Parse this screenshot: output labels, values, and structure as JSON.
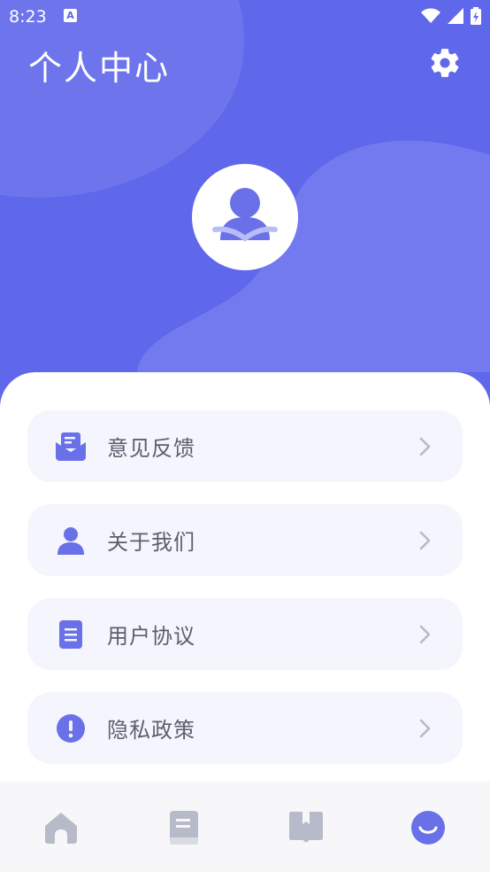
{
  "status_bar": {
    "time": "8:23",
    "notification_icon": "A"
  },
  "header": {
    "title": "个人中心"
  },
  "menu": {
    "items": [
      {
        "label": "意见反馈",
        "icon": "mail-icon"
      },
      {
        "label": "关于我们",
        "icon": "person-icon"
      },
      {
        "label": "用户协议",
        "icon": "document-icon"
      },
      {
        "label": "隐私政策",
        "icon": "exclamation-icon"
      }
    ]
  },
  "tabbar": {
    "tabs": [
      {
        "icon": "home-icon",
        "active": false
      },
      {
        "icon": "book-icon",
        "active": false
      },
      {
        "icon": "bookmark-book-icon",
        "active": false
      },
      {
        "icon": "smile-icon",
        "active": true
      }
    ]
  },
  "colors": {
    "primary": "#5f67ea",
    "icon_active": "#6a70e8",
    "icon_inactive": "#b7bac8",
    "item_bg": "#f4f5fd",
    "label": "#5c5f6e"
  }
}
